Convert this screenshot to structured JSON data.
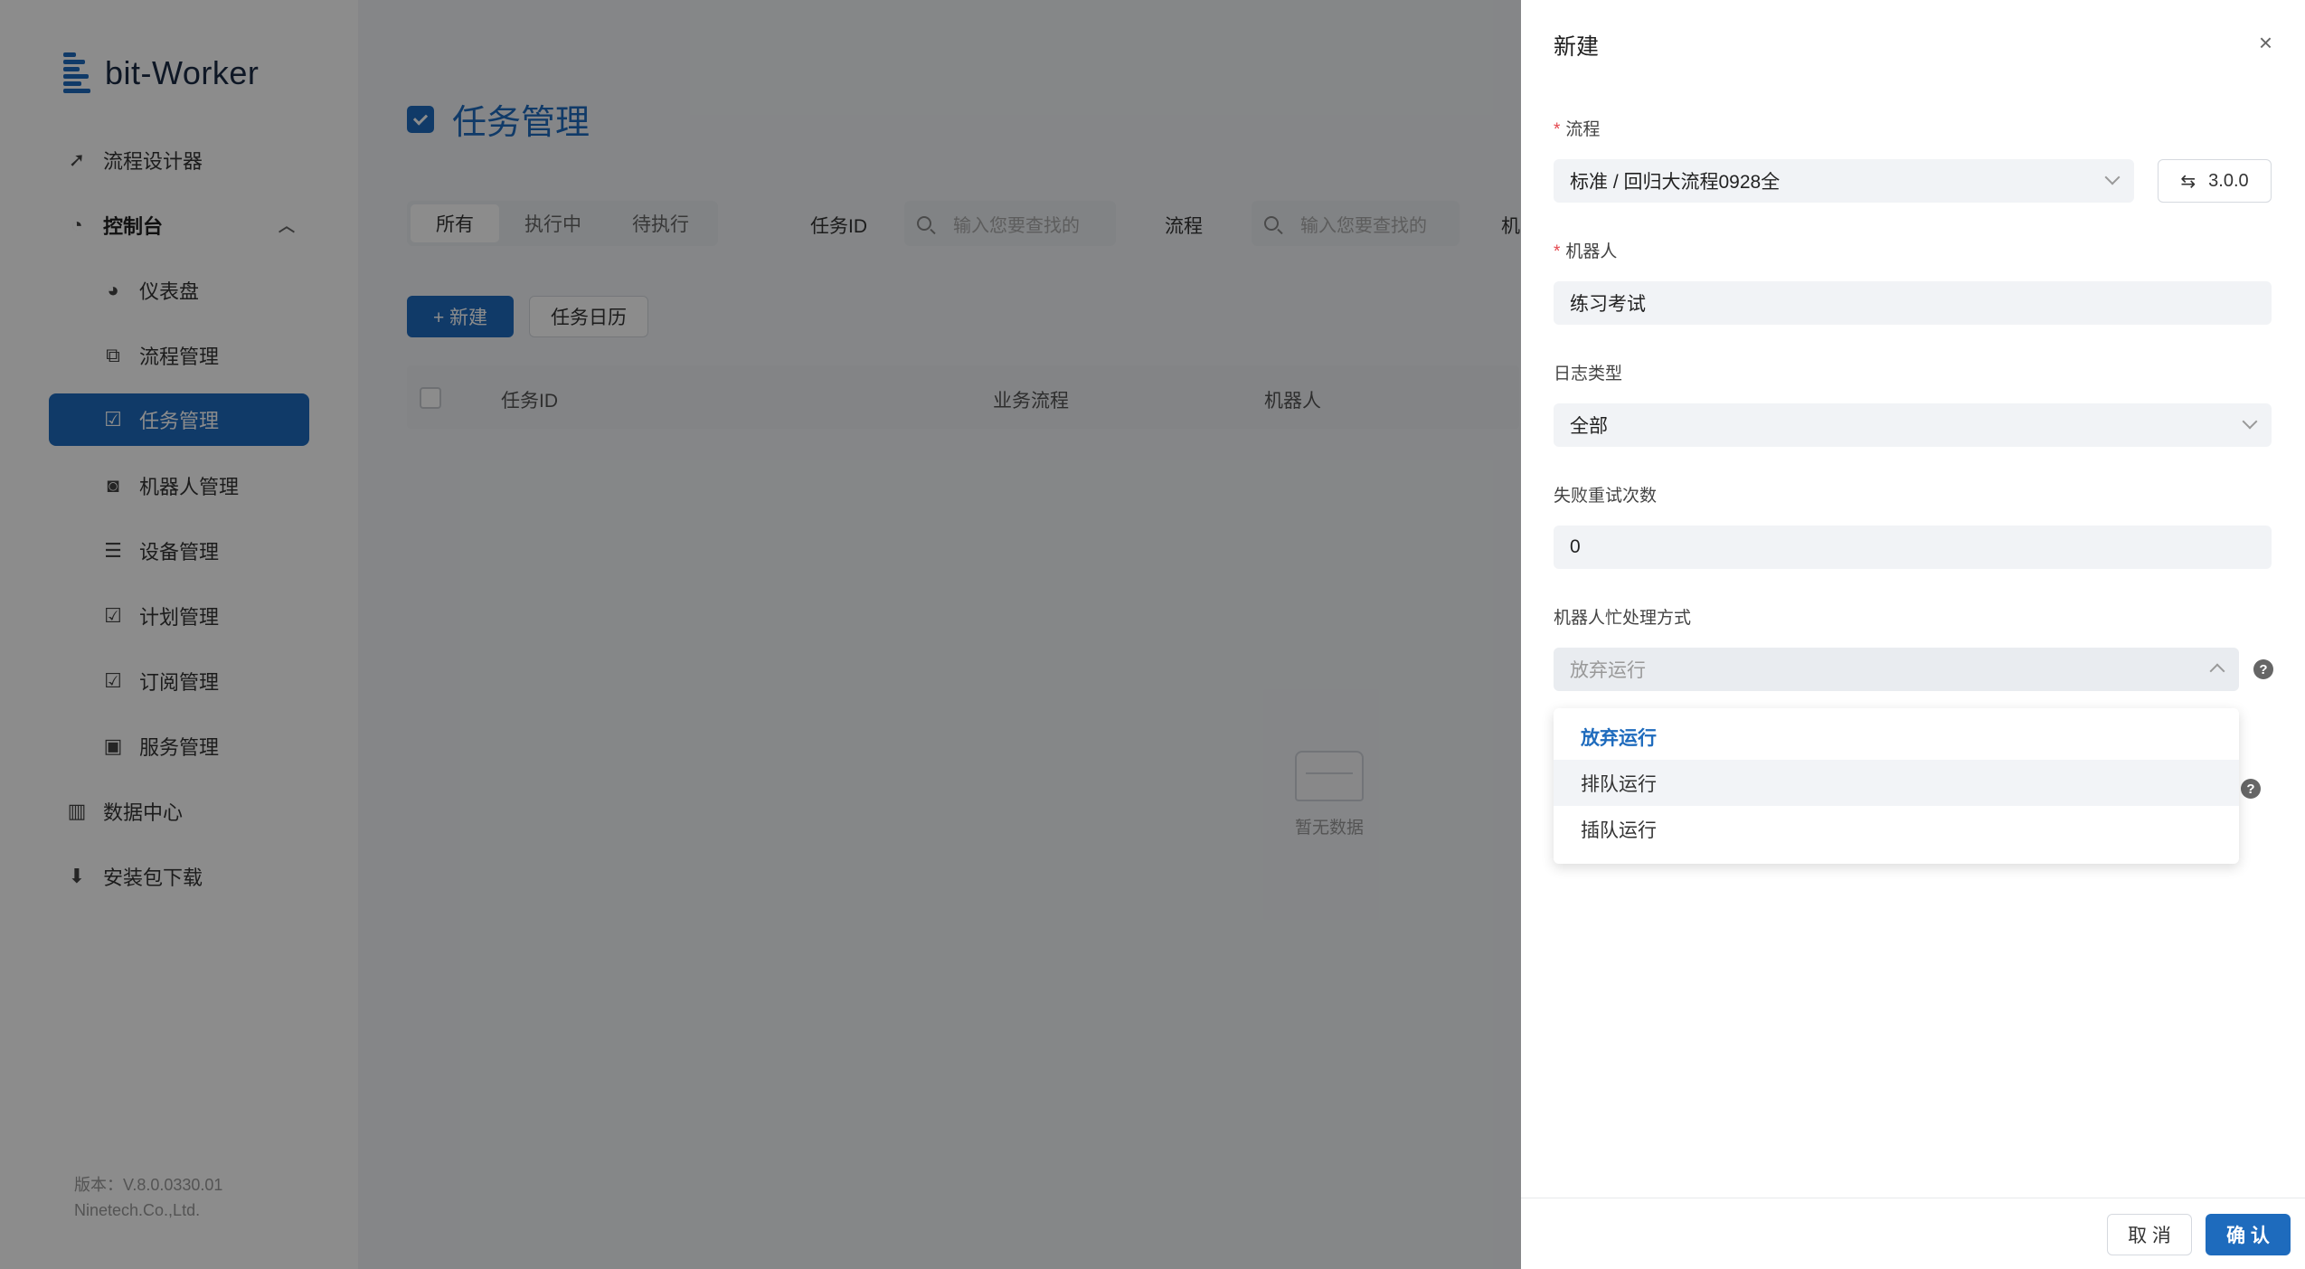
{
  "app": {
    "logo_text": "bit-Worker"
  },
  "sidebar": {
    "items": [
      {
        "label": "流程设计器",
        "icon": "compass-icon"
      },
      {
        "label": "控制台",
        "icon": "pie-icon"
      },
      {
        "label": "仪表盘",
        "icon": "pie-icon"
      },
      {
        "label": "流程管理",
        "icon": "flow-icon"
      },
      {
        "label": "任务管理",
        "icon": "task-check-icon"
      },
      {
        "label": "机器人管理",
        "icon": "robot-icon"
      },
      {
        "label": "设备管理",
        "icon": "server-icon"
      },
      {
        "label": "计划管理",
        "icon": "plan-check-icon"
      },
      {
        "label": "订阅管理",
        "icon": "subscribe-icon"
      },
      {
        "label": "服务管理",
        "icon": "service-icon"
      },
      {
        "label": "数据中心",
        "icon": "bar-chart-icon"
      },
      {
        "label": "安装包下载",
        "icon": "download-icon"
      }
    ],
    "version": "版本：V.8.0.0330.01",
    "company": "Ninetech.Co.,Ltd."
  },
  "main": {
    "title": "任务管理",
    "tabs": [
      "所有",
      "执行中",
      "待执行"
    ],
    "filters": {
      "task_id_label": "任务ID",
      "task_id_placeholder": "输入您要查找的",
      "flow_label": "流程",
      "flow_placeholder": "输入您要查找的",
      "cut_label": "机"
    },
    "new_button": "+ 新建",
    "calendar_button": "任务日历",
    "table_headers": [
      "任务ID",
      "业务流程",
      "机器人"
    ],
    "empty_text": "暂无数据"
  },
  "drawer": {
    "title": "新建",
    "close": "×",
    "flow": {
      "label": "流程",
      "value": "标准 / 回归大流程0928全",
      "version": "3.0.0"
    },
    "robot": {
      "label": "机器人",
      "value": "练习考试"
    },
    "log_type": {
      "label": "日志类型",
      "value": "全部"
    },
    "retry": {
      "label": "失败重试次数",
      "value": "0"
    },
    "busy_mode": {
      "label": "机器人忙处理方式",
      "value": "放弃运行",
      "options": [
        "放弃运行",
        "排队运行",
        "插队运行"
      ]
    },
    "cancel_button": "取 消",
    "confirm_button": "确 认"
  },
  "colors": {
    "accent": "#1e6bbd",
    "required": "#e4474e"
  }
}
